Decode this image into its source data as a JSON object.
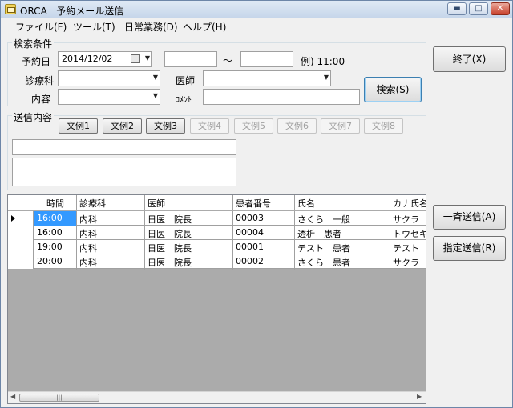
{
  "window": {
    "app": "ORCA",
    "title": "予約メール送信"
  },
  "window_buttons": {
    "minimize": "▬",
    "maximize": "□",
    "close": "✕"
  },
  "menu": [
    "ファイル(F)",
    "ツール(T)",
    "日常業務(D)",
    "ヘルプ(H)"
  ],
  "search": {
    "group_label": "検索条件",
    "date_label": "予約日",
    "date_value": "2014/12/02",
    "time_from": "",
    "tilde": "〜",
    "time_to": "",
    "time_example": "例) 11:00",
    "department_label": "診療科",
    "department_value": "",
    "doctor_label": "医師",
    "doctor_value": "",
    "content_label": "内容",
    "content_value": "",
    "comment_label": "ｺﾒﾝﾄ",
    "comment_value": "",
    "search_button": "検索(S)"
  },
  "send": {
    "group_label": "送信内容",
    "templates": [
      "文例1",
      "文例2",
      "文例3",
      "文例4",
      "文例5",
      "文例6",
      "文例7",
      "文例8"
    ],
    "subject_value": "",
    "body_value": ""
  },
  "buttons": {
    "close": "終了(X)",
    "send_all": "一斉送信(A)",
    "send_selected": "指定送信(R)"
  },
  "table": {
    "columns": [
      "時間",
      "診療科",
      "医師",
      "患者番号",
      "氏名",
      "カナ氏名"
    ],
    "rows": [
      {
        "time": "16:00",
        "dept": "内科",
        "doctor": "日医　院長",
        "patient_no": "00003",
        "name": "さくら　一般",
        "kana": "サクラ　イ"
      },
      {
        "time": "16:00",
        "dept": "内科",
        "doctor": "日医　院長",
        "patient_no": "00004",
        "name": "透析　患者",
        "kana": "トウセキ"
      },
      {
        "time": "19:00",
        "dept": "内科",
        "doctor": "日医　院長",
        "patient_no": "00001",
        "name": "テスト　患者",
        "kana": "テスト　カ"
      },
      {
        "time": "20:00",
        "dept": "内科",
        "doctor": "日医　院長",
        "patient_no": "00002",
        "name": "さくら　患者",
        "kana": "サクラ　カ"
      }
    ],
    "scroll_left": "◀",
    "scroll_right": "▶",
    "scroll_grip": "|||"
  },
  "icons": {
    "combo": "▼",
    "calendar": "calendar-icon"
  }
}
